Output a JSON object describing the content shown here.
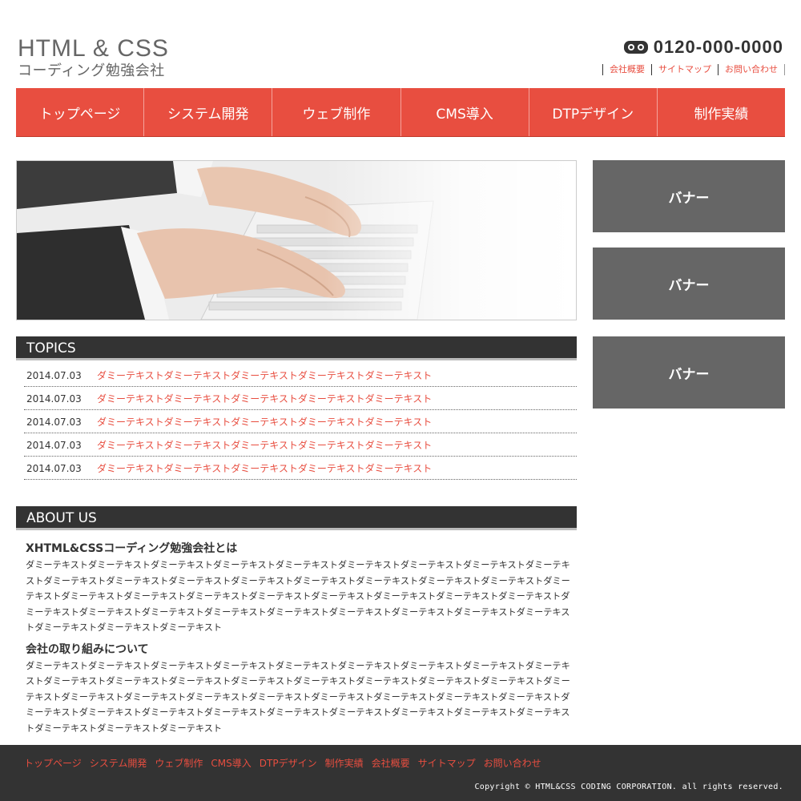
{
  "header": {
    "logo_line1": "HTML & CSS",
    "logo_line2": "コーディング勉強会社",
    "tel_icon": "free-dial-icon",
    "tel_number": "0120-000-0000",
    "util_links": [
      "会社概要",
      "サイトマップ",
      "お問い合わせ"
    ]
  },
  "global_nav": [
    "トップページ",
    "システム開発",
    "ウェブ制作",
    "CMS導入",
    "DTPデザイン",
    "制作実績"
  ],
  "hero": {
    "image": "hands-on-keyboard"
  },
  "topics": {
    "heading": "TOPICS",
    "items": [
      {
        "date": "2014.07.03",
        "text": "ダミーテキストダミーテキストダミーテキストダミーテキストダミーテキスト"
      },
      {
        "date": "2014.07.03",
        "text": "ダミーテキストダミーテキストダミーテキストダミーテキストダミーテキスト"
      },
      {
        "date": "2014.07.03",
        "text": "ダミーテキストダミーテキストダミーテキストダミーテキストダミーテキスト"
      },
      {
        "date": "2014.07.03",
        "text": "ダミーテキストダミーテキストダミーテキストダミーテキストダミーテキスト"
      },
      {
        "date": "2014.07.03",
        "text": "ダミーテキストダミーテキストダミーテキストダミーテキストダミーテキスト"
      }
    ]
  },
  "about": {
    "heading": "ABOUT US",
    "sections": [
      {
        "title": "XHTML&CSSコーディング勉強会社とは",
        "body": "ダミーテキストダミーテキストダミーテキストダミーテキストダミーテキストダミーテキストダミーテキストダミーテキストダミーテキストダミーテキストダミーテキストダミーテキストダミーテキストダミーテキストダミーテキストダミーテキストダミーテキストダミーテキストダミーテキストダミーテキストダミーテキストダミーテキストダミーテキストダミーテキストダミーテキストダミーテキストダミーテキストダミーテキストダミーテキストダミーテキストダミーテキストダミーテキストダミーテキストダミーテキストダミーテキストダミーテキストダミーテキストダミーテキスト"
      },
      {
        "title": "会社の取り組みについて",
        "body": "ダミーテキストダミーテキストダミーテキストダミーテキストダミーテキストダミーテキストダミーテキストダミーテキストダミーテキストダミーテキストダミーテキストダミーテキストダミーテキストダミーテキストダミーテキストダミーテキストダミーテキストダミーテキストダミーテキストダミーテキストダミーテキストダミーテキストダミーテキストダミーテキストダミーテキストダミーテキストダミーテキストダミーテキストダミーテキストダミーテキストダミーテキストダミーテキストダミーテキストダミーテキストダミーテキストダミーテキストダミーテキストダミーテキスト"
      }
    ]
  },
  "banners": [
    "バナー",
    "バナー",
    "バナー"
  ],
  "footer": {
    "nav": [
      "トップページ",
      "システム開発",
      "ウェブ制作",
      "CMS導入",
      "DTPデザイン",
      "制作実績",
      "会社概要",
      "サイトマップ",
      "お問い合わせ"
    ],
    "copyright": "Copyright © HTML&CSS CODING CORPORATION. all rights reserved."
  },
  "colors": {
    "accent": "#e84e40",
    "dark": "#333333",
    "banner": "#666666"
  }
}
